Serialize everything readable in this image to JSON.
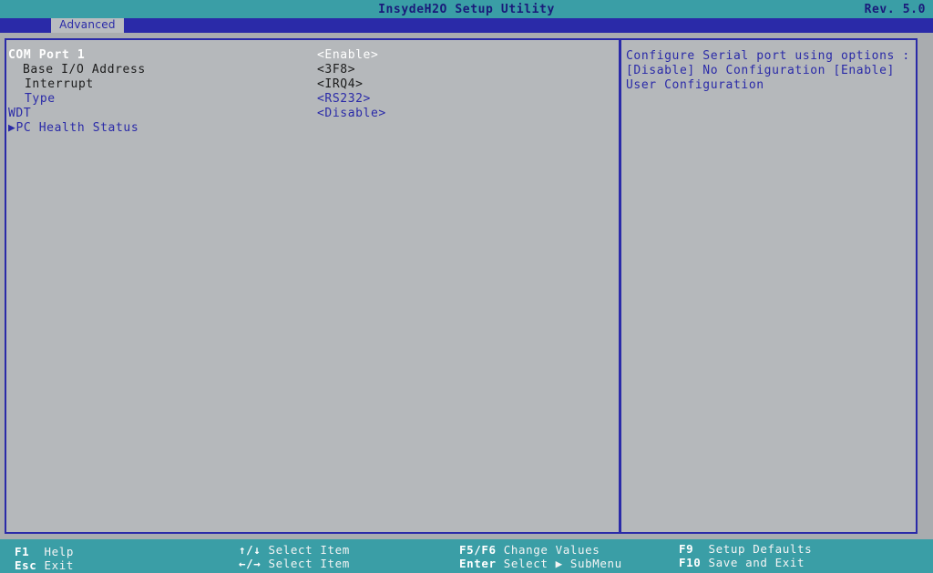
{
  "window": {
    "title": "InsydeH2O Setup Utility",
    "revision": "Rev. 5.0"
  },
  "tabs": [
    {
      "label": "Advanced",
      "active": true
    }
  ],
  "settings": [
    {
      "label": "COM Port 1",
      "value": "<Enable>",
      "selected": true
    },
    {
      "label": "Base I/O Address",
      "value": "<3F8>"
    },
    {
      "label": "Interrupt",
      "value": "<IRQ4>"
    },
    {
      "label": "Type",
      "value": "<RS232>"
    },
    {
      "label": "WDT",
      "value": "<Disable>"
    },
    {
      "label": "PC Health Status",
      "submenu": true
    }
  ],
  "help": {
    "text": "Configure Serial port using options : [Disable] No Configuration [Enable] User Configuration"
  },
  "footer": {
    "f1_key": "F1",
    "f1_action": "Help",
    "esc_key": "Esc",
    "esc_action": "Exit",
    "updown_key": "↑/↓",
    "updown_action": "Select Item",
    "leftright_key": "←/→",
    "leftright_action": "Select Item",
    "f5f6_key": "F5/F6",
    "f5f6_action": "Change Values",
    "enter_key": "Enter",
    "enter_action": "Select ▶ SubMenu",
    "f9_key": "F9",
    "f9_action": "Setup Defaults",
    "f10_key": "F10",
    "f10_action": "Save and Exit"
  },
  "colors": {
    "title_bar": "#3a9ea6",
    "tab_bar": "#2a2aa8",
    "panel_bg": "#b5b8bb",
    "border": "#2a2aa8"
  }
}
